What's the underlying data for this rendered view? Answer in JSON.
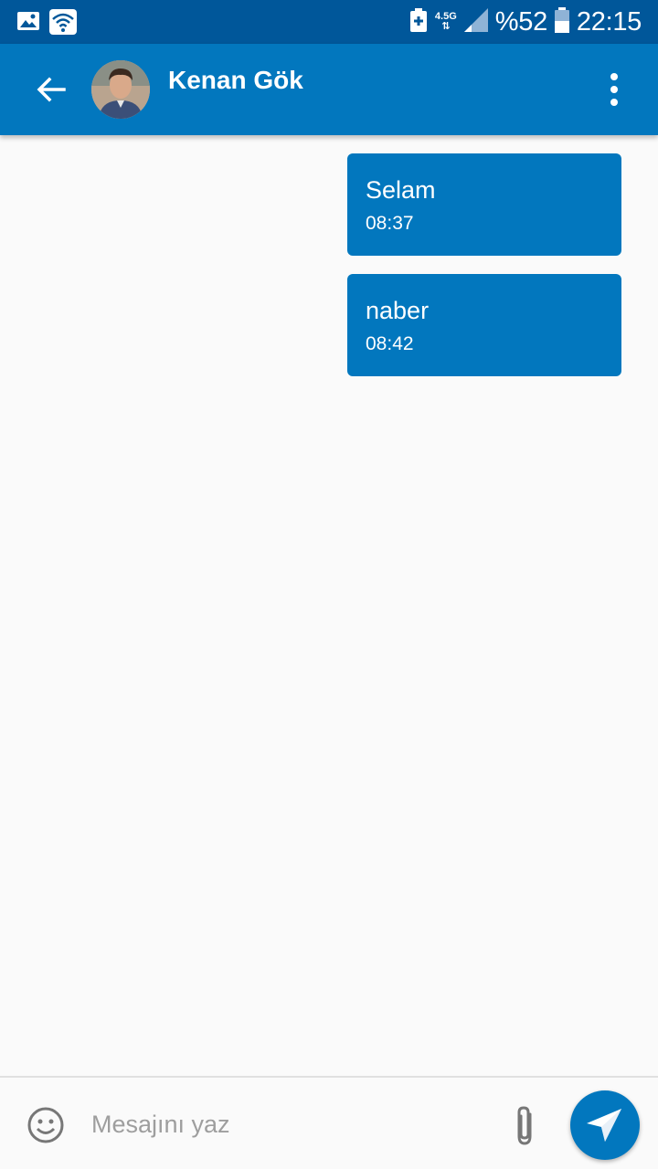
{
  "status_bar": {
    "network_type": "4.5G",
    "battery_percent": "%52",
    "time": "22:15",
    "icons": [
      "gallery-icon",
      "wifi-icon",
      "battery-saver-icon",
      "signal-icon",
      "battery-icon"
    ]
  },
  "header": {
    "contact_name": "Kenan Gök",
    "back_icon": "arrow-left-icon",
    "menu_icon": "more-vertical-icon"
  },
  "messages": [
    {
      "text": "Selam",
      "time": "08:37"
    },
    {
      "text": "naber",
      "time": "08:42"
    }
  ],
  "composer": {
    "placeholder": "Mesajını yaz",
    "value": "",
    "emoji_icon": "emoji-icon",
    "attach_icon": "paperclip-icon",
    "send_icon": "send-icon"
  },
  "colors": {
    "status_bar": "#00579a",
    "app_bar": "#0277be",
    "bubble": "#0277be",
    "background": "#fafafa"
  }
}
